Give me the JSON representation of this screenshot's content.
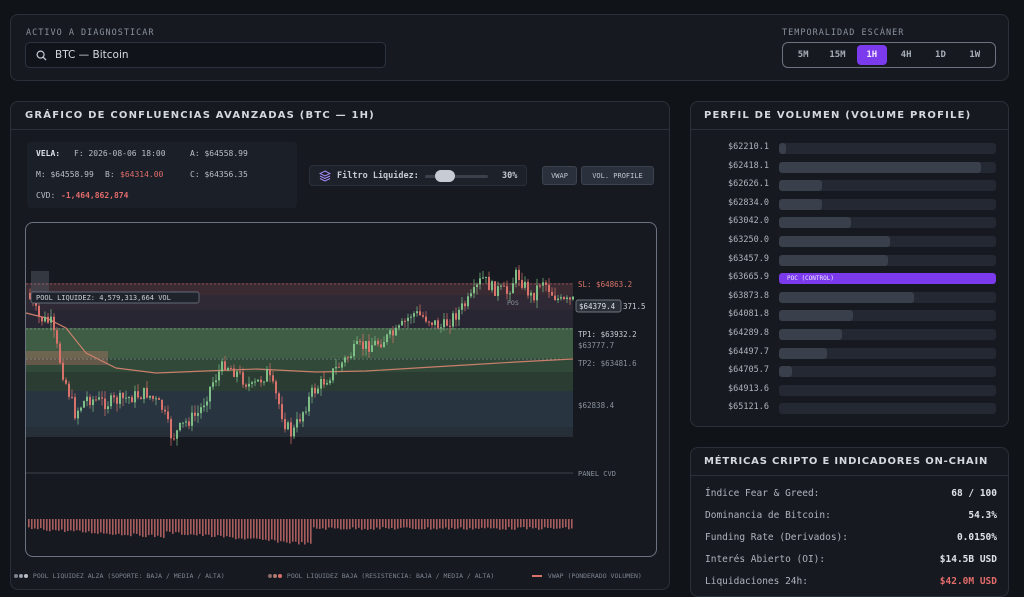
{
  "header": {
    "asset_label": "ACTIVO A DIAGNOSTICAR",
    "search_value": "BTC — Bitcoin",
    "timeframe_label": "TEMPORALIDAD ESCÁNER",
    "timeframes": [
      "5M",
      "15M",
      "1H",
      "4H",
      "1D",
      "1W"
    ],
    "active_timeframe": "1H"
  },
  "chart_panel": {
    "title": "GRÁFICO DE CONFLUENCIAS AVANZADAS (BTC — 1H)",
    "candle": {
      "vela_label": "VELA:",
      "f": "F: 2026-08-06 18:00",
      "a": "A: $64558.99",
      "m": "M: $64558.99",
      "b_label": "B:",
      "b_value": "$64314.00",
      "c": "C: $64356.35",
      "cvd_label": "CVD:",
      "cvd_value": "-1,464,862,874"
    },
    "filter": {
      "label": "Filtro Liquidez:",
      "value": "30%",
      "level": 0.3
    },
    "buttons": {
      "vwap": "VWAP",
      "vol_profile": "VOL. PROFILE"
    },
    "annotations": {
      "pool": "POOL LIQUIDEZ: 4,579,313,664 VOL",
      "sl": "SL: $64863.2",
      "price_tag": "$64379.4",
      "price_right": "371.5",
      "tp1": "TP1: $63932.2",
      "lvl1": "$63777.7",
      "tp2": "TP2: $63481.6",
      "lvl2": "$62838.4",
      "cvd_panel": "PANEL CVD",
      "pos": "POS"
    },
    "legend": {
      "alza": "POOL LIQUIDEZ ALZA (SOPORTE: BAJA / MEDIA / ALTA)",
      "baja": "POOL LIQUIDEZ BAJA (RESISTENCIA: BAJA / MEDIA / ALTA)",
      "vwap": "VWAP (PONDERADO VOLUMEN)"
    },
    "colors": {
      "up": "#7dbf86",
      "down": "#d9726a",
      "vwap": "#c9806a",
      "accent": "#7c3aed"
    }
  },
  "volume_profile": {
    "title": "PERFIL DE VOLUMEN (VOLUME PROFILE)",
    "poc_label": "POC (CONTROL)",
    "rows": [
      {
        "price": "$62210.1",
        "level": 0.03
      },
      {
        "price": "$62418.1",
        "level": 0.93
      },
      {
        "price": "$62626.1",
        "level": 0.2
      },
      {
        "price": "$62834.0",
        "level": 0.2
      },
      {
        "price": "$63042.0",
        "level": 0.33
      },
      {
        "price": "$63250.0",
        "level": 0.51
      },
      {
        "price": "$63457.9",
        "level": 0.5
      },
      {
        "price": "$63665.9",
        "level": 1.0,
        "poc": true
      },
      {
        "price": "$63873.8",
        "level": 0.62
      },
      {
        "price": "$64081.8",
        "level": 0.34
      },
      {
        "price": "$64289.8",
        "level": 0.29
      },
      {
        "price": "$64497.7",
        "level": 0.22
      },
      {
        "price": "$64705.7",
        "level": 0.06
      },
      {
        "price": "$64913.6",
        "level": 0.0
      },
      {
        "price": "$65121.6",
        "level": 0.0
      }
    ]
  },
  "metrics": {
    "title": "MÉTRICAS CRIPTO E INDICADORES ON-CHAIN",
    "rows": [
      {
        "label": "Índice Fear & Greed:",
        "value": "68 / 100"
      },
      {
        "label": "Dominancia de Bitcoin:",
        "value": "54.3%"
      },
      {
        "label": "Funding Rate (Derivados):",
        "value": "0.0150%"
      },
      {
        "label": "Interés Abierto (OI):",
        "value": "$14.5B USD"
      },
      {
        "label": "Liquidaciones 24h:",
        "value": "$42.0M USD",
        "negative": true
      }
    ]
  }
}
